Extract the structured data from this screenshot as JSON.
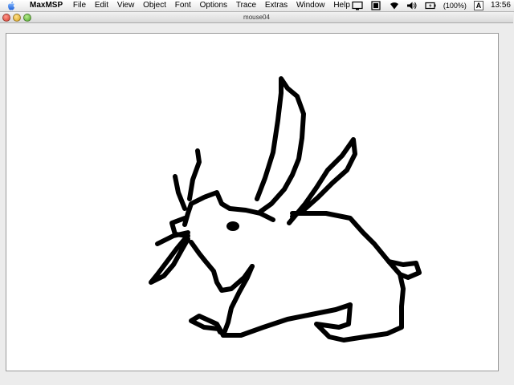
{
  "menubar": {
    "app_name": "MaxMSP",
    "menus": [
      "File",
      "Edit",
      "View",
      "Object",
      "Font",
      "Options",
      "Trace",
      "Extras",
      "Window",
      "Help"
    ],
    "battery_text": "(100%)",
    "input_menu": "A",
    "clock": "13:56"
  },
  "window": {
    "title": "mouse04"
  },
  "drawing": {
    "stroke_color": "#000000",
    "background_color": "#ffffff"
  }
}
